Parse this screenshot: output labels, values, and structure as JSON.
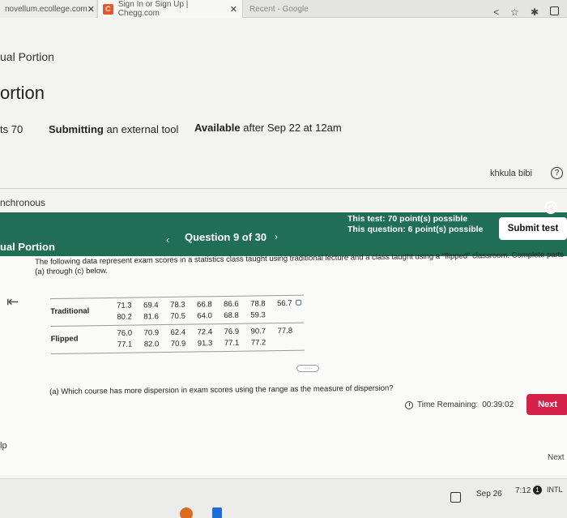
{
  "browser": {
    "tabs": [
      {
        "label": "novellum.ecollege.com",
        "close": "✕"
      },
      {
        "label": "Sign In or Sign Up | Chegg.com",
        "close": "✕",
        "favicon": "C"
      },
      {
        "label": "Recent - Google"
      }
    ],
    "icons": [
      "share-icon",
      "star-icon",
      "extension-icon",
      "window-icon"
    ]
  },
  "lms": {
    "crumb": "ual Portion",
    "title": "ortion",
    "points": "ts 70",
    "submitting_label": "Submitting",
    "submitting_value": "an external tool",
    "available_label": "Available",
    "available_value": "after Sep 22 at 12am",
    "user_name": "khkula bibi",
    "help": "?",
    "sync_label": "nchronous"
  },
  "quiz": {
    "portion_label": "ual Portion",
    "question_title": "Question 9 of 30",
    "prev": "‹",
    "next": "›",
    "test_points": "This test: 70 point(s) possible",
    "question_points": "This question: 6 point(s) possible",
    "submit_label": "Submit test",
    "back": "⇤",
    "prompt_line1": "The following data represent exam scores in a statistics class taught using traditional lecture and a class taught using a \"flipped\" classroom. Complete parts",
    "prompt_line2": "(a) through (c) below.",
    "table": {
      "traditional_label": "Traditional",
      "traditional_rows": [
        [
          "71.3",
          "69.4",
          "78.3",
          "66.8",
          "86.6",
          "78.8",
          "56.7"
        ],
        [
          "80.2",
          "81.6",
          "70.5",
          "64.0",
          "68.8",
          "59.3",
          ""
        ]
      ],
      "flipped_label": "Flipped",
      "flipped_rows": [
        [
          "76.0",
          "70.9",
          "62.4",
          "72.4",
          "76.9",
          "90.7",
          "77.8"
        ],
        [
          "77.1",
          "82.0",
          "70.9",
          "91.3",
          "77.1",
          "77.2",
          ""
        ]
      ]
    },
    "more": "·····",
    "part_a": "(a) Which course has more dispersion in exam scores using the range as the measure of dispersion?",
    "time_label": "Time Remaining:",
    "time_value": "00:39:02",
    "next_label": "Next",
    "help_left": "lp",
    "next_right": "Next"
  },
  "taskbar": {
    "date": "Sep 26",
    "time": "7:12",
    "badge": "1",
    "lang": "INTL"
  },
  "colors": {
    "header_green": "#1f6e55",
    "next_red": "#d3214a",
    "chegg_orange": "#e8562a"
  }
}
